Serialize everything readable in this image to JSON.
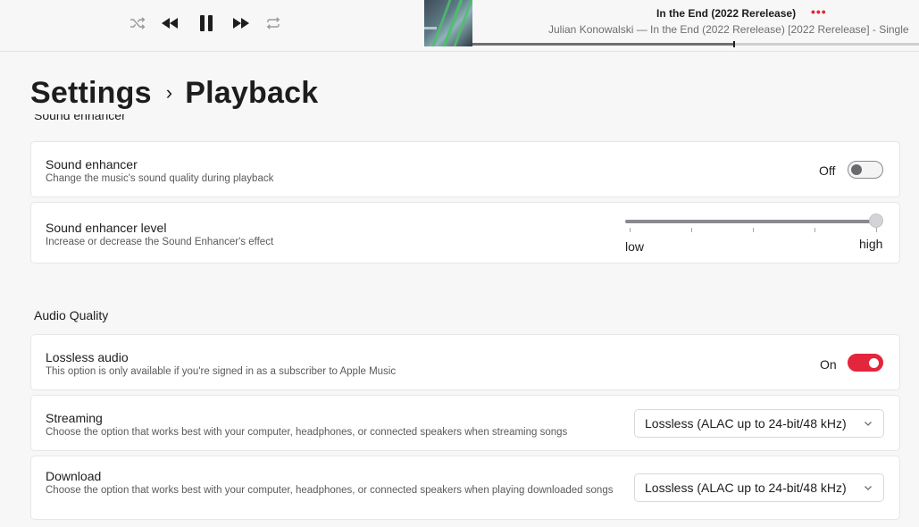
{
  "player": {
    "icons": {
      "shuffle": "shuffle-icon",
      "rewind": "rewind-icon",
      "pause": "pause-icon",
      "forward": "fast-forward-icon",
      "repeat": "repeat-icon"
    },
    "track_title": "In the End (2022 Rerelease)",
    "more_label": "•••",
    "track_subtitle": "Julian Konowalski — In the End (2022 Rerelease) [2022 Rerelease] - Single",
    "progress": 0.585
  },
  "breadcrumb": {
    "parent": "Settings",
    "separator": "›",
    "current": "Playback"
  },
  "clipped_section_label": "Sound enhancer",
  "sound_enhancer": {
    "title": "Sound enhancer",
    "description": "Change the music's sound quality during playback",
    "state_label": "Off",
    "enabled": false
  },
  "sound_enhancer_level": {
    "title": "Sound enhancer level",
    "description": "Increase or decrease the Sound Enhancer's effect",
    "min_label": "low",
    "max_label": "high",
    "value": 1.0,
    "ticks": 5
  },
  "audio_quality": {
    "header": "Audio Quality",
    "lossless": {
      "title": "Lossless audio",
      "description": "This option is only available if you're signed in as a subscriber to Apple Music",
      "state_label": "On",
      "enabled": true
    },
    "streaming": {
      "title": "Streaming",
      "description": "Choose the option that works best with your computer, headphones, or connected speakers when streaming songs",
      "selected": "Lossless (ALAC up to 24-bit/48 kHz)"
    },
    "download": {
      "title": "Download",
      "description": "Choose the option that works best with your computer, headphones, or connected speakers when playing downloaded songs",
      "selected": "Lossless (ALAC up to 24-bit/48 kHz)"
    }
  },
  "colors": {
    "accent": "#e3263b",
    "background": "#f7f7f7",
    "card": "#ffffff"
  }
}
